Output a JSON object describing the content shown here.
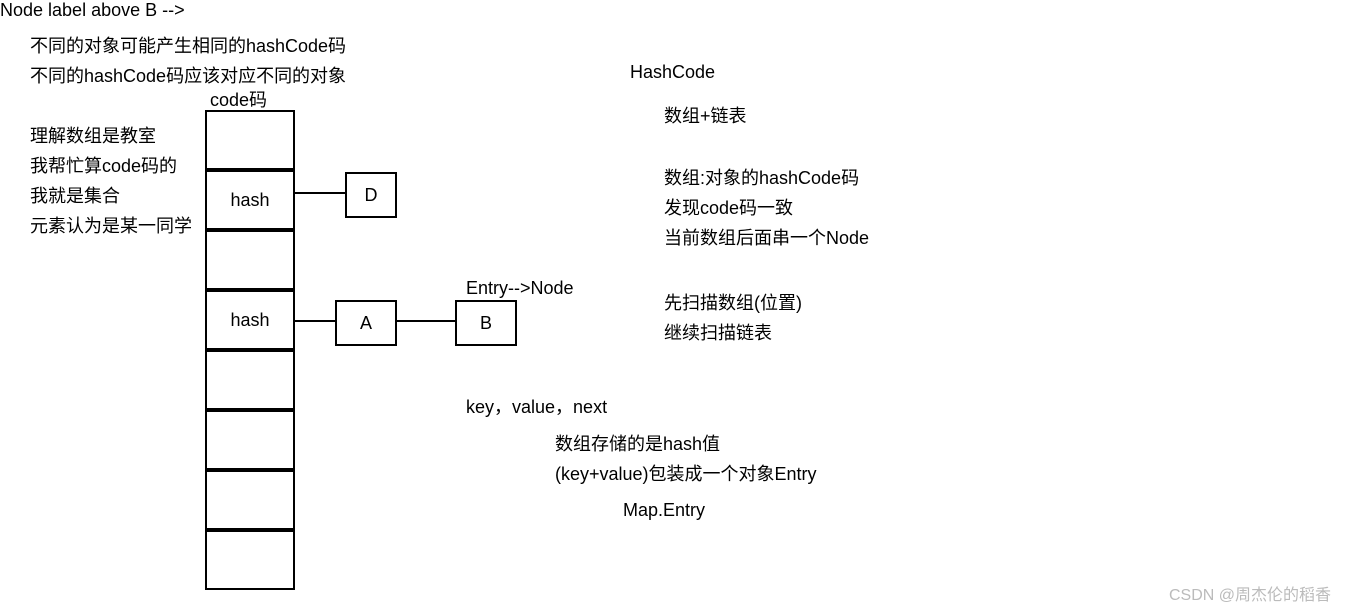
{
  "header": {
    "line1": "不同的对象可能产生相同的hashCode码",
    "line2": "不同的hashCode码应该对应不同的对象"
  },
  "left_notes": {
    "l1": "理解数组是教室",
    "l2": "我帮忙算code码的",
    "l3": "我就是集合",
    "l4": "元素认为是某一同学"
  },
  "array": {
    "title": "code码",
    "cells": [
      "",
      "hash",
      "",
      "hash",
      "",
      "",
      "",
      ""
    ]
  },
  "nodes": {
    "D": "D",
    "A": "A",
    "B": "B",
    "entry_label": "Entry-->Node"
  },
  "right": {
    "title": "HashCode",
    "r1": "数组+链表",
    "r2": "数组:对象的hashCode码",
    "r3": "发现code码一致",
    "r4": "当前数组后面串一个Node",
    "r5": "先扫描数组(位置)",
    "r6": "继续扫描链表"
  },
  "bottom": {
    "kv": "key，value，next",
    "b1": "数组存储的是hash值",
    "b2": "(key+value)包装成一个对象Entry",
    "b3": "Map.Entry"
  },
  "watermark": "CSDN @周杰伦的稻香"
}
